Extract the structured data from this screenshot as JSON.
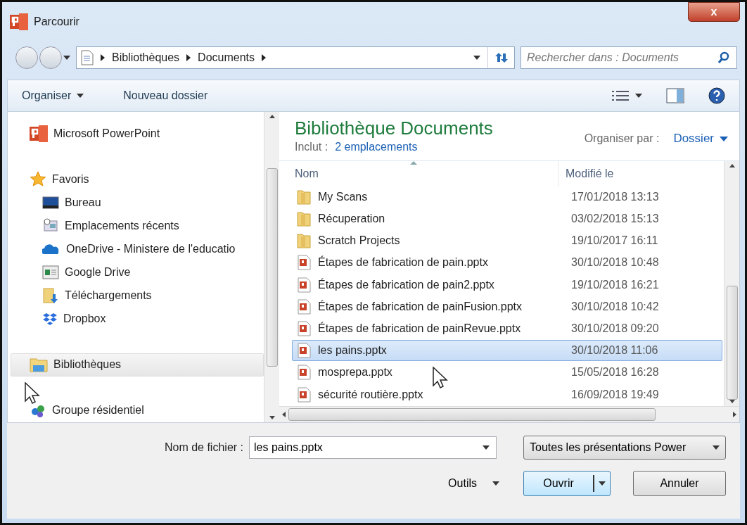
{
  "window": {
    "title": "Parcourir",
    "close": "x"
  },
  "address": {
    "crumbs": [
      "Bibliothèques",
      "Documents"
    ],
    "search_placeholder": "Rechercher dans : Documents"
  },
  "toolbar": {
    "organize": "Organiser",
    "new_folder": "Nouveau dossier"
  },
  "nav": [
    {
      "label": "Microsoft PowerPoint",
      "kind": "app",
      "selected": false
    },
    {
      "label": "Favoris",
      "kind": "star",
      "selected": false,
      "children": [
        {
          "label": "Bureau",
          "kind": "desktop",
          "selected": false
        },
        {
          "label": "Emplacements récents",
          "kind": "recent",
          "selected": false
        },
        {
          "label": "OneDrive - Ministere de l'educatio",
          "kind": "cloud",
          "selected": false
        },
        {
          "label": "Google Drive",
          "kind": "window",
          "selected": false
        },
        {
          "label": "Téléchargements",
          "kind": "download",
          "selected": false
        },
        {
          "label": "Dropbox",
          "kind": "dropbox",
          "selected": false
        }
      ]
    },
    {
      "label": "Bibliothèques",
      "kind": "library",
      "selected": true
    },
    {
      "label": "Groupe résidentiel",
      "kind": "homegroup",
      "selected": false
    }
  ],
  "library": {
    "title": "Bibliothèque Documents",
    "includes_label": "Inclut :",
    "includes_link": "2 emplacements",
    "arrange_label": "Organiser par :",
    "arrange_value": "Dossier"
  },
  "columns": [
    "Nom",
    "Modifié le"
  ],
  "files": [
    {
      "name": "My Scans",
      "date": "17/01/2018 13:13",
      "kind": "folder",
      "selected": false
    },
    {
      "name": "Récuperation",
      "date": "03/02/2018 15:13",
      "kind": "folder",
      "selected": false
    },
    {
      "name": "Scratch Projects",
      "date": "19/10/2017 16:11",
      "kind": "folder",
      "selected": false
    },
    {
      "name": "Étapes de fabrication de pain.pptx",
      "date": "30/10/2018 10:48",
      "kind": "pptx",
      "selected": false
    },
    {
      "name": "Étapes de fabrication de pain2.pptx",
      "date": "19/10/2018 16:21",
      "kind": "pptx",
      "selected": false
    },
    {
      "name": "Étapes de fabrication de painFusion.pptx",
      "date": "30/10/2018 10:42",
      "kind": "pptx",
      "selected": false
    },
    {
      "name": "Étapes de fabrication de painRevue.pptx",
      "date": "30/10/2018 09:20",
      "kind": "pptx",
      "selected": false
    },
    {
      "name": "les pains.pptx",
      "date": "30/10/2018 11:06",
      "kind": "pptx",
      "selected": true
    },
    {
      "name": "mosprepa.pptx",
      "date": "15/05/2018 16:28",
      "kind": "pptx",
      "selected": false
    },
    {
      "name": "sécurité routière.pptx",
      "date": "16/09/2018 19:49",
      "kind": "pptx",
      "selected": false
    }
  ],
  "footer": {
    "filename_label": "Nom de fichier :",
    "filename": "les pains.pptx",
    "filter": "Toutes les présentations Power",
    "tools": "Outils",
    "open": "Ouvrir",
    "cancel": "Annuler"
  }
}
